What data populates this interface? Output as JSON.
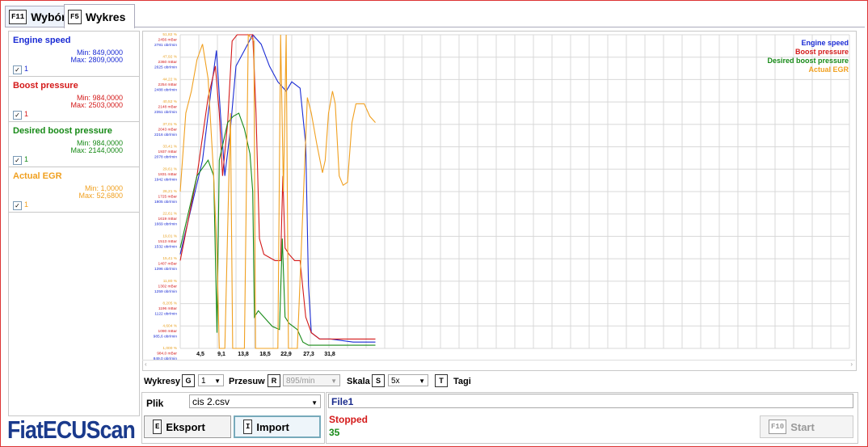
{
  "tabs": [
    {
      "key": "F11",
      "label": "Wybór"
    },
    {
      "key": "F5",
      "label": "Wykres"
    }
  ],
  "signals": [
    {
      "name": "Engine speed",
      "min": "Min: 849,0000",
      "max": "Max: 2809,0000",
      "color": "#1a2bd4",
      "check": "1"
    },
    {
      "name": "Boost pressure",
      "min": "Min: 984,0000",
      "max": "Max: 2503,0000",
      "color": "#d41a1a",
      "check": "1"
    },
    {
      "name": "Desired boost pressure",
      "min": "Min: 984,0000",
      "max": "Max: 2144,0000",
      "color": "#178a17",
      "check": "1"
    },
    {
      "name": "Actual EGR",
      "min": "Min: 1,0000",
      "max": "Max: 52,6800",
      "color": "#f0a020",
      "check": "1"
    }
  ],
  "chart_data": {
    "type": "line",
    "x_ticks": [
      "4,5",
      "9,1",
      "13,8",
      "18,5",
      "22,9",
      "27,3",
      "31,8"
    ],
    "y_axis_labels": [
      [
        "51,82 %",
        "2456 mBar",
        "2781 obr/min"
      ],
      [
        "47,92 %",
        "2360 mBar",
        "2625 obr/min"
      ],
      [
        "44,22 %",
        "2254 mBar",
        "2488 obr/min"
      ],
      [
        "40,52 %",
        "2148 mBar",
        "2351 obr/min"
      ],
      [
        "37,01 %",
        "2043 mBar",
        "2216 obr/min"
      ],
      [
        "33,41 %",
        "1937 mBar",
        "2078 obr/min"
      ],
      [
        "29,61 %",
        "1831 mBar",
        "1942 obr/min"
      ],
      [
        "26,21 %",
        "1725 mBar",
        "1805 obr/min"
      ],
      [
        "22,61 %",
        "1619 mBar",
        "1669 obr/min"
      ],
      [
        "19,01 %",
        "1513 mBar",
        "1532 obr/min"
      ],
      [
        "15,41 %",
        "1407 mBar",
        "1396 obr/min"
      ],
      [
        "11,80 %",
        "1302 mBar",
        "1259 obr/min"
      ],
      [
        "8,205 %",
        "1196 mBar",
        "1122 obr/min"
      ],
      [
        "4,604 %",
        "1090 mBar",
        "985,6 obr/min"
      ],
      [
        "1,000 %",
        "984,0 mBar",
        "849,0 obr/min"
      ]
    ],
    "legend": [
      "Engine speed",
      "Boost pressure",
      "Desired boost pressure",
      "Actual EGR"
    ],
    "legend_position": "top-right",
    "grid": true,
    "series": [
      {
        "name": "Engine speed",
        "color": "#1a2bd4",
        "pts": [
          [
            0,
            0.3
          ],
          [
            4,
            0.6
          ],
          [
            5.5,
            0.82
          ],
          [
            6.5,
            0.95
          ],
          [
            7.2,
            0.75
          ],
          [
            8,
            0.55
          ],
          [
            9,
            0.7
          ],
          [
            10,
            0.9
          ],
          [
            11.5,
            0.95
          ],
          [
            13,
            1.0
          ],
          [
            14.5,
            0.97
          ],
          [
            16,
            0.9
          ],
          [
            17.5,
            0.85
          ],
          [
            19,
            0.82
          ],
          [
            20,
            0.85
          ],
          [
            21.5,
            0.83
          ],
          [
            22.5,
            0.65
          ],
          [
            23,
            0.2
          ],
          [
            23.5,
            0.05
          ],
          [
            25,
            0.03
          ],
          [
            27,
            0.03
          ],
          [
            31,
            0.02
          ],
          [
            35,
            0.02
          ]
        ]
      },
      {
        "name": "Boost pressure",
        "color": "#d41a1a",
        "pts": [
          [
            0,
            0.28
          ],
          [
            3,
            0.55
          ],
          [
            5,
            0.8
          ],
          [
            6.3,
            0.9
          ],
          [
            7,
            0.75
          ],
          [
            7.6,
            0.55
          ],
          [
            8.5,
            0.72
          ],
          [
            9.3,
            0.98
          ],
          [
            10.2,
            1.0
          ],
          [
            13,
            1.0
          ],
          [
            13.6,
            0.75
          ],
          [
            14.2,
            0.35
          ],
          [
            15,
            0.3
          ],
          [
            17,
            0.28
          ],
          [
            18,
            0.28
          ],
          [
            18.4,
            0.55
          ],
          [
            18.8,
            0.32
          ],
          [
            19.5,
            0.3
          ],
          [
            20.5,
            0.28
          ],
          [
            21.5,
            0.28
          ],
          [
            22.5,
            0.1
          ],
          [
            23.5,
            0.05
          ],
          [
            25,
            0.03
          ],
          [
            35,
            0.03
          ]
        ]
      },
      {
        "name": "Desired boost pressure",
        "color": "#178a17",
        "pts": [
          [
            0,
            0.32
          ],
          [
            3,
            0.55
          ],
          [
            5,
            0.6
          ],
          [
            6,
            0.55
          ],
          [
            6.6,
            0.05
          ],
          [
            7,
            0.6
          ],
          [
            8.5,
            0.72
          ],
          [
            9.5,
            0.74
          ],
          [
            10.5,
            0.75
          ],
          [
            11.5,
            0.7
          ],
          [
            12.5,
            0.62
          ],
          [
            13,
            0.5
          ],
          [
            13.3,
            0.1
          ],
          [
            14,
            0.12
          ],
          [
            15,
            0.1
          ],
          [
            16.5,
            0.07
          ],
          [
            17.8,
            0.06
          ],
          [
            18.3,
            0.35
          ],
          [
            18.8,
            0.1
          ],
          [
            19.5,
            0.08
          ],
          [
            21,
            0.06
          ],
          [
            22,
            0.02
          ],
          [
            23,
            0.01
          ],
          [
            35,
            0.01
          ]
        ]
      },
      {
        "name": "Actual EGR",
        "color": "#f0a020",
        "pts": [
          [
            0,
            0.5
          ],
          [
            1,
            0.75
          ],
          [
            2,
            0.82
          ],
          [
            3,
            0.92
          ],
          [
            4,
            0.97
          ],
          [
            5,
            0.86
          ],
          [
            6,
            0.55
          ],
          [
            6.6,
            0.3
          ],
          [
            7,
            0.0
          ],
          [
            8,
            0.0
          ],
          [
            9,
            0.75
          ],
          [
            9.4,
            0.0
          ],
          [
            11.5,
            0.0
          ],
          [
            12.2,
            1.0
          ],
          [
            13.2,
            0.98
          ],
          [
            13.5,
            0.0
          ],
          [
            17.5,
            0.0
          ],
          [
            18,
            1.0
          ],
          [
            18.5,
            0.5
          ],
          [
            19,
            1.0
          ],
          [
            19.4,
            0.0
          ],
          [
            21,
            0.0
          ],
          [
            22.8,
            0.8
          ],
          [
            23.5,
            0.75
          ],
          [
            24.5,
            0.65
          ],
          [
            25.5,
            0.56
          ],
          [
            26,
            0.6
          ],
          [
            26.6,
            0.75
          ],
          [
            27.3,
            0.82
          ],
          [
            27.8,
            0.78
          ],
          [
            28.5,
            0.55
          ],
          [
            29.2,
            0.52
          ],
          [
            30,
            0.53
          ],
          [
            30.8,
            0.72
          ],
          [
            31.5,
            0.78
          ],
          [
            33,
            0.78
          ],
          [
            34,
            0.74
          ],
          [
            35,
            0.72
          ]
        ]
      }
    ]
  },
  "controls": {
    "wykresy_label": "Wykresy",
    "wykresy_key": "G",
    "wykresy_value": "1",
    "przesuw_label": "Przesuw",
    "przesuw_key": "R",
    "przesuw_value": "895/min",
    "skala_label": "Skala",
    "skala_key": "S",
    "skala_value": "5x",
    "tagi_key": "T",
    "tagi_label": "Tagi"
  },
  "file": {
    "plik_label": "Plik",
    "plik_value": "cis 2.csv",
    "eksport_key": "E",
    "eksport_label": "Eksport",
    "import_key": "I",
    "import_label": "Import"
  },
  "status": {
    "file_name": "File1",
    "state": "Stopped",
    "count": "35",
    "start_key": "F10",
    "start_label": "Start"
  },
  "logo": "FiatECUScan",
  "colors": {
    "frame": "#d33",
    "logo": "#1a3a8c",
    "stopped": "#d41a1a",
    "count": "#178a17"
  }
}
